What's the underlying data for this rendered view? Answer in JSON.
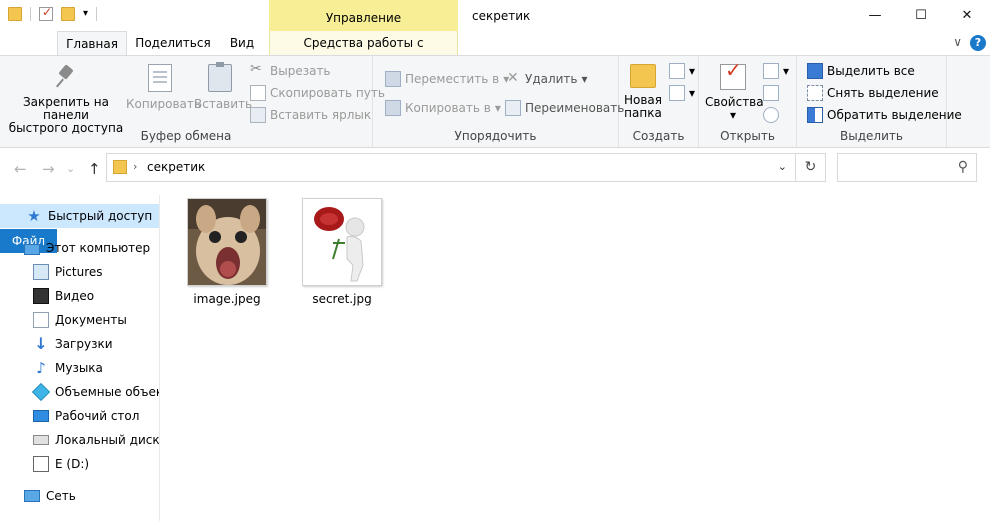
{
  "window": {
    "title": "секретик",
    "contextual_header": "Управление",
    "controls": {
      "minimize": "—",
      "maximize": "☐",
      "close": "✕"
    }
  },
  "tabs": [
    {
      "label": "Файл"
    },
    {
      "label": "Главная"
    },
    {
      "label": "Поделиться"
    },
    {
      "label": "Вид"
    },
    {
      "label": "Средства работы с рисунками"
    }
  ],
  "ribbon_expand_glyph": "∨",
  "help_glyph": "?",
  "ribbon": {
    "clipboard": {
      "label": "Буфер обмена",
      "pin_line1": "Закрепить на панели",
      "pin_line2": "быстрого доступа",
      "copy": "Копировать",
      "paste": "Вставить",
      "cut": "Вырезать",
      "copy_path": "Скопировать путь",
      "paste_shortcut": "Вставить ярлык"
    },
    "organize": {
      "label": "Упорядочить",
      "move_to": "Переместить в",
      "copy_to": "Копировать в",
      "delete": "Удалить",
      "rename": "Переименовать"
    },
    "new": {
      "label": "Создать",
      "new_folder_line1": "Новая",
      "new_folder_line2": "папка"
    },
    "open": {
      "label": "Открыть",
      "properties": "Свойства"
    },
    "select": {
      "label": "Выделить",
      "select_all": "Выделить все",
      "select_none": "Снять выделение",
      "invert": "Обратить выделение"
    }
  },
  "address": {
    "path": "секретик",
    "separator": "›",
    "dropdown": "⌄",
    "refresh": "↻",
    "search_placeholder": ""
  },
  "nav_arrows": {
    "back": "←",
    "forward": "→",
    "history": "⌄",
    "up": "↑"
  },
  "navpane": [
    {
      "label": "Быстрый доступ"
    },
    {
      "label": "Этот компьютер"
    },
    {
      "label": "Pictures"
    },
    {
      "label": "Видео"
    },
    {
      "label": "Документы"
    },
    {
      "label": "Загрузки"
    },
    {
      "label": "Музыка"
    },
    {
      "label": "Объемные объекты"
    },
    {
      "label": "Рабочий стол"
    },
    {
      "label": "Локальный диск (C:)"
    },
    {
      "label": "E (D:)"
    },
    {
      "label": "Сеть"
    }
  ],
  "files": [
    {
      "name": "image.jpeg"
    },
    {
      "name": "secret.jpg"
    }
  ]
}
